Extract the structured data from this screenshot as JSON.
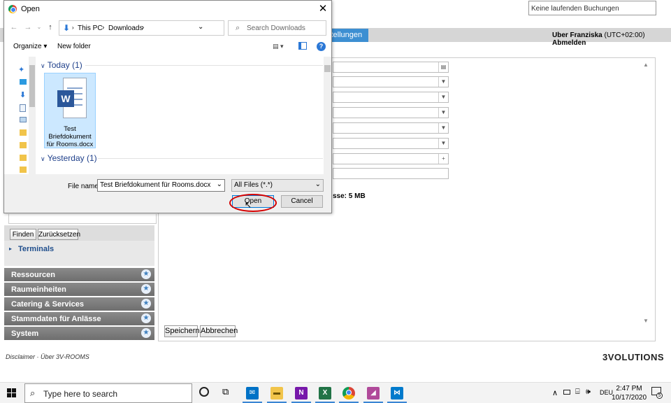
{
  "app": {
    "booking_status": "Keine laufenden Buchungen",
    "active_tab": "stellungen",
    "user_prefix": "Uber Franziska",
    "timezone": "(UTC+02:00)",
    "logout": "Abmelden",
    "upload_size_note": "sse: 5 MB",
    "save_button": "Speichern",
    "cancel_button": "Abbrechen",
    "search_button": "Finden",
    "reset_button": "Zurücksetzen",
    "terminals": "Terminals",
    "sections": [
      "Ressourcen",
      "Raumeinheiten",
      "Catering & Services",
      "Stammdaten für Anlässe",
      "System"
    ],
    "footer_disclaimer": "Disclaimer",
    "footer_about": "Über 3V-ROOMS",
    "logo": "3VOLUTIONS"
  },
  "dialog": {
    "title": "Open",
    "breadcrumb": [
      "This PC",
      "Downloads"
    ],
    "search_placeholder": "Search Downloads",
    "organize": "Organize",
    "new_folder": "New folder",
    "group_today": "Today (1)",
    "group_yesterday": "Yesterday (1)",
    "file_name_lines": [
      "Test",
      "Briefdokument",
      "für Rooms.docx"
    ],
    "file_name_label": "File name:",
    "file_name_value": "Test Briefdokument für Rooms.docx",
    "file_type": "All Files (*.*)",
    "open_button": "Open",
    "cancel_button": "Cancel"
  },
  "taskbar": {
    "search_placeholder": "Type here to search",
    "language": "DEU",
    "time": "2:47 PM",
    "date": "10/17/2020",
    "notification_count": "5"
  },
  "colors": {
    "accent": "#3d8fd2",
    "highlight_ellipse": "#d40000",
    "selection": "#cce8ff",
    "word_blue": "#2b579a"
  }
}
